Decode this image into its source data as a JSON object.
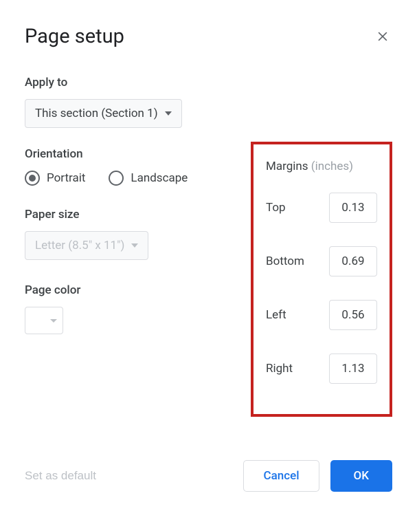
{
  "dialog": {
    "title": "Page setup"
  },
  "applyTo": {
    "label": "Apply to",
    "selected": "This section (Section 1)"
  },
  "orientation": {
    "label": "Orientation",
    "portrait": "Portrait",
    "landscape": "Landscape"
  },
  "paperSize": {
    "label": "Paper size",
    "selected": "Letter (8.5\" x 11\")"
  },
  "pageColor": {
    "label": "Page color"
  },
  "margins": {
    "label": "Margins",
    "unit": "(inches)",
    "top": {
      "label": "Top",
      "value": "0.13"
    },
    "bottom": {
      "label": "Bottom",
      "value": "0.69"
    },
    "left": {
      "label": "Left",
      "value": "0.56"
    },
    "right": {
      "label": "Right",
      "value": "1.13"
    }
  },
  "footer": {
    "setDefault": "Set as default",
    "cancel": "Cancel",
    "ok": "OK"
  }
}
